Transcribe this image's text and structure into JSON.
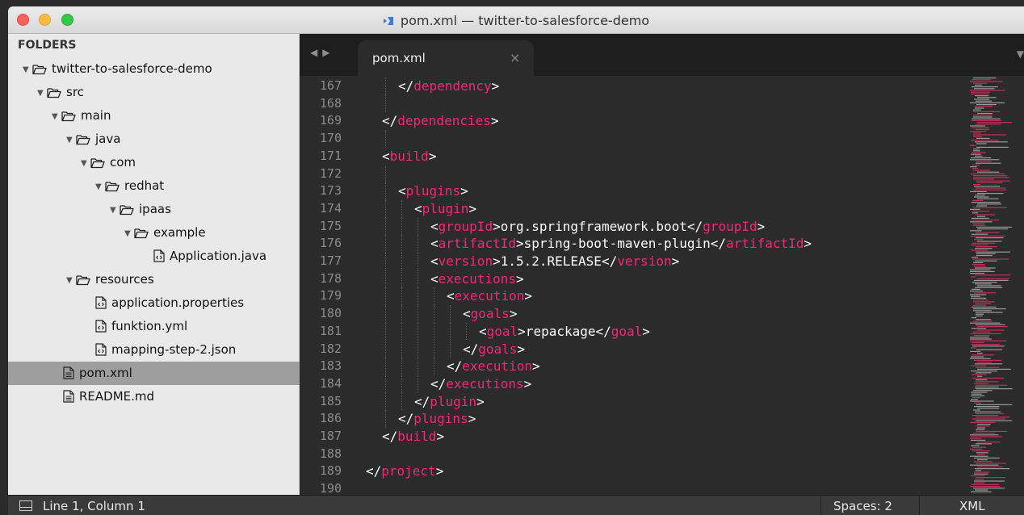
{
  "window": {
    "title": "pom.xml — twitter-to-salesforce-demo"
  },
  "sidebar": {
    "header": "FOLDERS",
    "items": [
      {
        "label": "twitter-to-salesforce-demo",
        "type": "folder",
        "depth": 0,
        "expanded": true
      },
      {
        "label": "src",
        "type": "folder",
        "depth": 1,
        "expanded": true
      },
      {
        "label": "main",
        "type": "folder",
        "depth": 2,
        "expanded": true
      },
      {
        "label": "java",
        "type": "folder",
        "depth": 3,
        "expanded": true
      },
      {
        "label": "com",
        "type": "folder",
        "depth": 4,
        "expanded": true
      },
      {
        "label": "redhat",
        "type": "folder",
        "depth": 5,
        "expanded": true
      },
      {
        "label": "ipaas",
        "type": "folder",
        "depth": 6,
        "expanded": true
      },
      {
        "label": "example",
        "type": "folder",
        "depth": 7,
        "expanded": true
      },
      {
        "label": "Application.java",
        "type": "code-file",
        "depth": 8
      },
      {
        "label": "resources",
        "type": "folder",
        "depth": 3,
        "expanded": true
      },
      {
        "label": "application.properties",
        "type": "code-file",
        "depth": 4
      },
      {
        "label": "funktion.yml",
        "type": "code-file",
        "depth": 4
      },
      {
        "label": "mapping-step-2.json",
        "type": "code-file",
        "depth": 4
      },
      {
        "label": "pom.xml",
        "type": "doc-file",
        "depth": 1,
        "selected": true
      },
      {
        "label": "README.md",
        "type": "doc-file",
        "depth": 1
      }
    ]
  },
  "tabs": {
    "nav_icons": [
      "chevron-left-icon",
      "chevron-right-icon"
    ],
    "active": {
      "label": "pom.xml",
      "close": "×"
    },
    "menu_icon": "triangle-down-icon"
  },
  "editor": {
    "lines": [
      {
        "n": "167",
        "indent": 2,
        "parts": [
          [
            "p",
            "</"
          ],
          [
            "t",
            "dependency"
          ],
          [
            "p",
            ">"
          ]
        ]
      },
      {
        "n": "168",
        "indent": 0,
        "parts": []
      },
      {
        "n": "169",
        "indent": 1,
        "parts": [
          [
            "p",
            "</"
          ],
          [
            "t",
            "dependencies"
          ],
          [
            "p",
            ">"
          ]
        ]
      },
      {
        "n": "170",
        "indent": 0,
        "parts": []
      },
      {
        "n": "171",
        "indent": 1,
        "parts": [
          [
            "p",
            "<"
          ],
          [
            "t",
            "build"
          ],
          [
            "p",
            ">"
          ]
        ]
      },
      {
        "n": "172",
        "indent": 0,
        "parts": []
      },
      {
        "n": "173",
        "indent": 2,
        "parts": [
          [
            "p",
            "<"
          ],
          [
            "t",
            "plugins"
          ],
          [
            "p",
            ">"
          ]
        ]
      },
      {
        "n": "174",
        "indent": 3,
        "parts": [
          [
            "p",
            "<"
          ],
          [
            "t",
            "plugin"
          ],
          [
            "p",
            ">"
          ]
        ]
      },
      {
        "n": "175",
        "indent": 4,
        "parts": [
          [
            "p",
            "<"
          ],
          [
            "t",
            "groupId"
          ],
          [
            "p",
            ">org.springframework.boot</"
          ],
          [
            "t",
            "groupId"
          ],
          [
            "p",
            ">"
          ]
        ]
      },
      {
        "n": "176",
        "indent": 4,
        "parts": [
          [
            "p",
            "<"
          ],
          [
            "t",
            "artifactId"
          ],
          [
            "p",
            ">spring-boot-maven-plugin</"
          ],
          [
            "t",
            "artifactId"
          ],
          [
            "p",
            ">"
          ]
        ]
      },
      {
        "n": "177",
        "indent": 4,
        "parts": [
          [
            "p",
            "<"
          ],
          [
            "t",
            "version"
          ],
          [
            "p",
            ">1.5.2.RELEASE</"
          ],
          [
            "t",
            "version"
          ],
          [
            "p",
            ">"
          ]
        ]
      },
      {
        "n": "178",
        "indent": 4,
        "parts": [
          [
            "p",
            "<"
          ],
          [
            "t",
            "executions"
          ],
          [
            "p",
            ">"
          ]
        ]
      },
      {
        "n": "179",
        "indent": 5,
        "parts": [
          [
            "p",
            "<"
          ],
          [
            "t",
            "execution"
          ],
          [
            "p",
            ">"
          ]
        ]
      },
      {
        "n": "180",
        "indent": 6,
        "parts": [
          [
            "p",
            "<"
          ],
          [
            "t",
            "goals"
          ],
          [
            "p",
            ">"
          ]
        ]
      },
      {
        "n": "181",
        "indent": 7,
        "parts": [
          [
            "p",
            "<"
          ],
          [
            "t",
            "goal"
          ],
          [
            "p",
            ">repackage</"
          ],
          [
            "t",
            "goal"
          ],
          [
            "p",
            ">"
          ]
        ]
      },
      {
        "n": "182",
        "indent": 6,
        "parts": [
          [
            "p",
            "</"
          ],
          [
            "t",
            "goals"
          ],
          [
            "p",
            ">"
          ]
        ]
      },
      {
        "n": "183",
        "indent": 5,
        "parts": [
          [
            "p",
            "</"
          ],
          [
            "t",
            "execution"
          ],
          [
            "p",
            ">"
          ]
        ]
      },
      {
        "n": "184",
        "indent": 4,
        "parts": [
          [
            "p",
            "</"
          ],
          [
            "t",
            "executions"
          ],
          [
            "p",
            ">"
          ]
        ]
      },
      {
        "n": "185",
        "indent": 3,
        "parts": [
          [
            "p",
            "</"
          ],
          [
            "t",
            "plugin"
          ],
          [
            "p",
            ">"
          ]
        ]
      },
      {
        "n": "186",
        "indent": 2,
        "parts": [
          [
            "p",
            "</"
          ],
          [
            "t",
            "plugins"
          ],
          [
            "p",
            ">"
          ]
        ]
      },
      {
        "n": "187",
        "indent": 1,
        "parts": [
          [
            "p",
            "</"
          ],
          [
            "t",
            "build"
          ],
          [
            "p",
            ">"
          ]
        ]
      },
      {
        "n": "188",
        "indent": 0,
        "parts": []
      },
      {
        "n": "189",
        "indent": 0,
        "parts": [
          [
            "p",
            "</"
          ],
          [
            "t",
            "project"
          ],
          [
            "p",
            ">"
          ]
        ]
      },
      {
        "n": "190",
        "indent": 0,
        "parts": []
      }
    ]
  },
  "statusbar": {
    "panel_icon": "panel-toggle-icon",
    "position": "Line 1, Column 1",
    "spaces": "Spaces: 2",
    "syntax": "XML"
  },
  "colors": {
    "tag": "#f92672",
    "text": "#ffffff",
    "background": "#2b2b2b",
    "sidebar": "#e9e9e9",
    "selection": "#9e9e9e"
  }
}
